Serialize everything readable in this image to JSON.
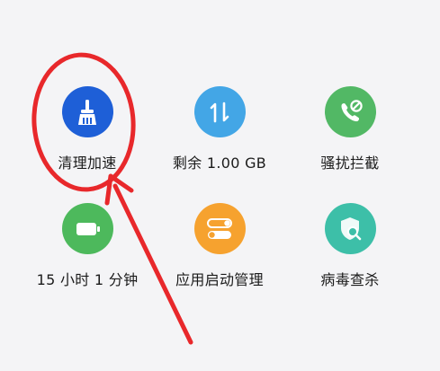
{
  "tiles": [
    {
      "id": "cleanup",
      "label": "清理加速",
      "icon": "broom-icon",
      "color": "#1e5fd7"
    },
    {
      "id": "storage",
      "label": "剩余 1.00 GB",
      "icon": "transfer-arrows-icon",
      "color": "#43a6e6"
    },
    {
      "id": "harassment",
      "label": "骚扰拦截",
      "icon": "phone-block-icon",
      "color": "#52b865"
    },
    {
      "id": "battery",
      "label": "15 小时 1 分钟",
      "icon": "battery-icon",
      "color": "#4db95c"
    },
    {
      "id": "app-launch",
      "label": "应用启动管理",
      "icon": "toggle-switches-icon",
      "color": "#f6a22f"
    },
    {
      "id": "virus-scan",
      "label": "病毒查杀",
      "icon": "shield-search-icon",
      "color": "#3dbfa8"
    }
  ],
  "annotation": {
    "color": "#e8282b",
    "shapes": [
      "ellipse-highlight",
      "arrow-pointer"
    ]
  }
}
